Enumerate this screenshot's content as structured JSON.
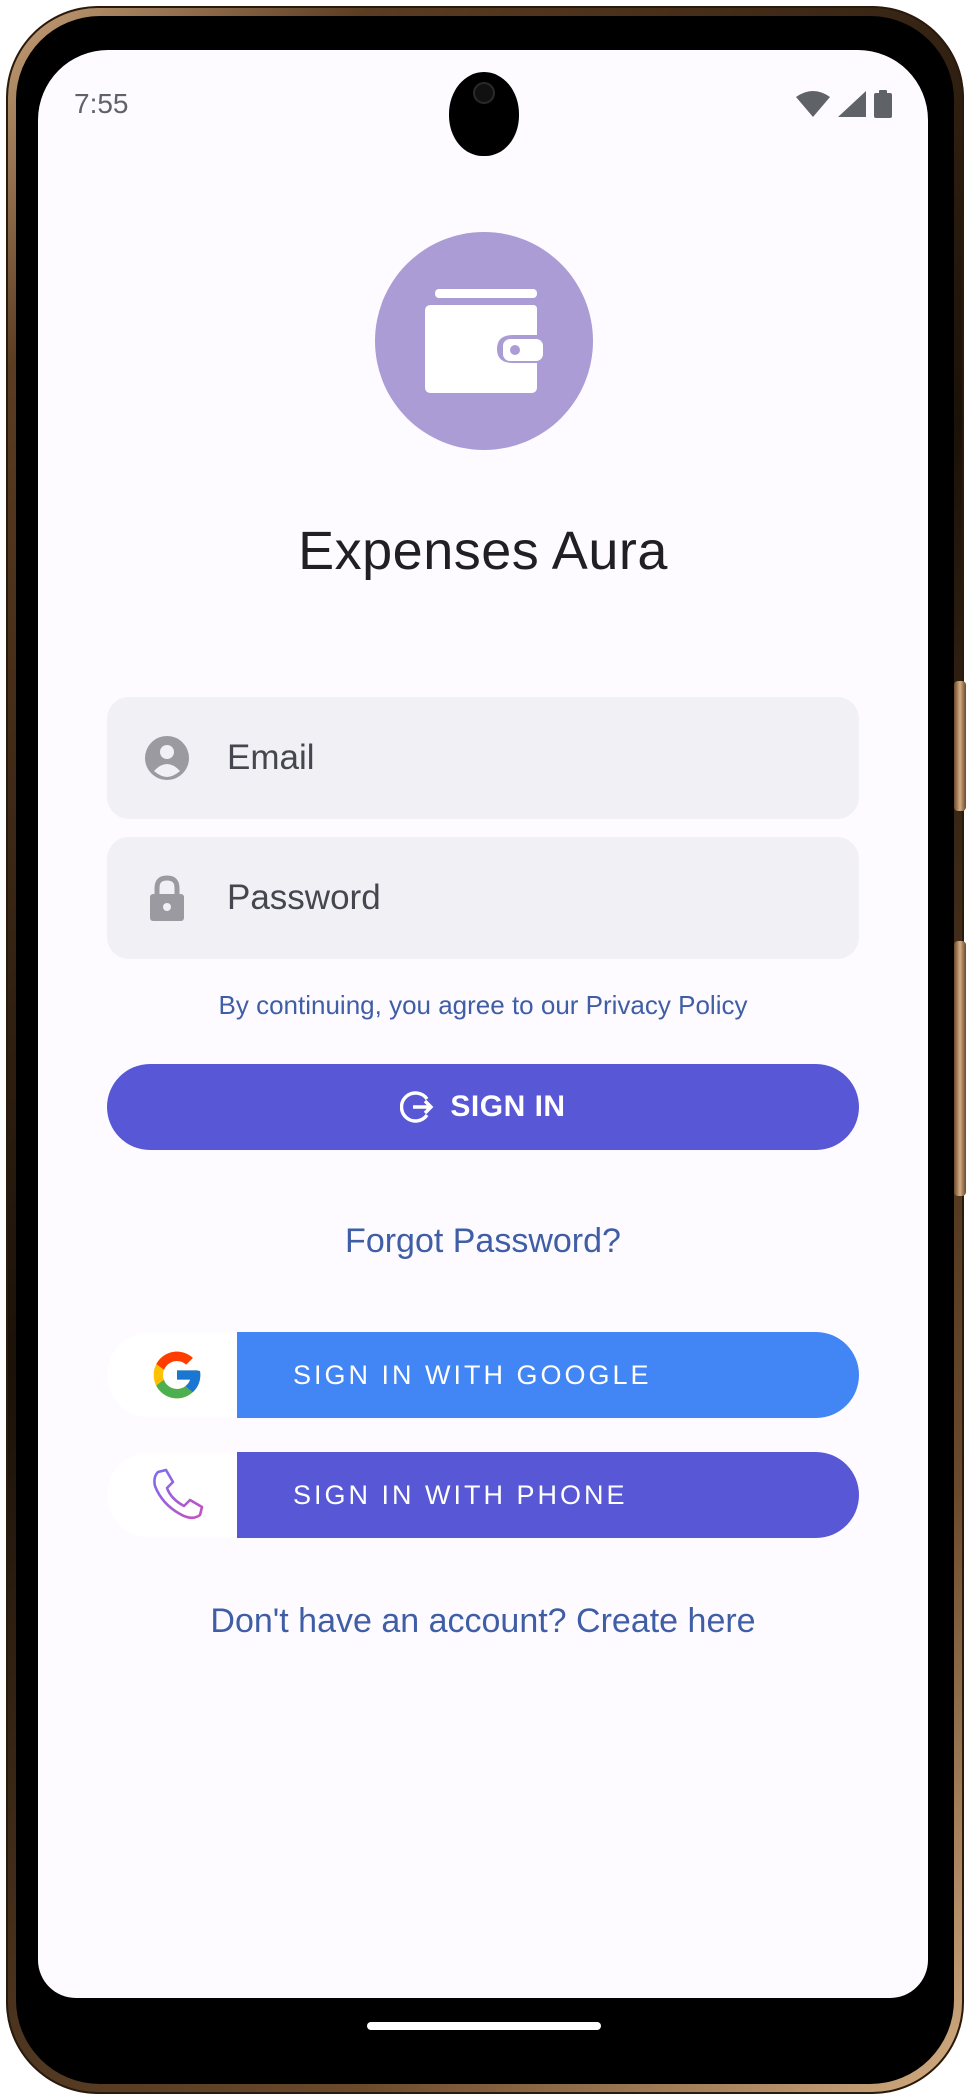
{
  "status_bar": {
    "time": "7:55"
  },
  "app": {
    "title": "Expenses Aura",
    "logo_icon": "wallet-icon",
    "logo_color": "#ab9cd6"
  },
  "form": {
    "email_placeholder": "Email",
    "password_placeholder": "Password",
    "privacy_text": "By continuing, you agree to our Privacy Policy",
    "signin_label": "SIGN IN",
    "forgot_label": "Forgot Password?"
  },
  "social": {
    "google_label": "SIGN IN WITH GOOGLE",
    "phone_label": "SIGN IN WITH PHONE",
    "google_color": "#4285f4",
    "phone_color": "#5858d6"
  },
  "footer": {
    "create_label": "Don't have an account? Create here"
  },
  "colors": {
    "primary": "#5858d6",
    "link": "#3f5ea6",
    "field_bg": "#f1f0f5"
  }
}
